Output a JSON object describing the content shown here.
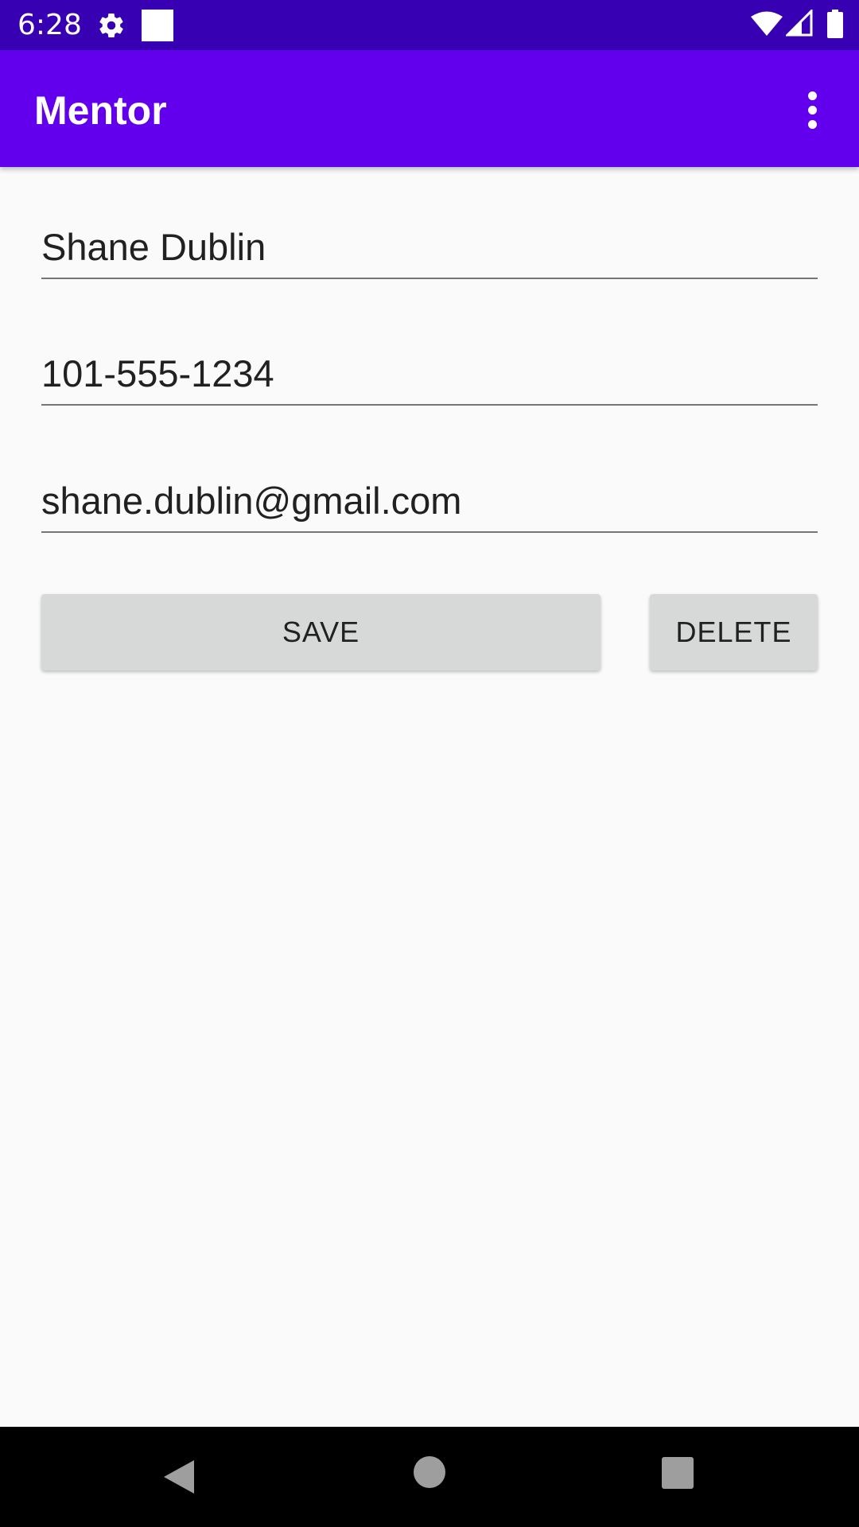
{
  "status_bar": {
    "time": "6:28",
    "icons": [
      "gear-icon",
      "notification-square-icon",
      "wifi-icon",
      "signal-icon",
      "battery-icon"
    ]
  },
  "app_bar": {
    "title": "Mentor",
    "menu_icon": "more-vert-icon"
  },
  "form": {
    "name_value": "Shane Dublin",
    "phone_value": "101-555-1234",
    "email_value": "shane.dublin@gmail.com"
  },
  "buttons": {
    "save_label": "SAVE",
    "delete_label": "DELETE"
  },
  "nav_bar": {
    "icons": [
      "back-icon",
      "home-icon",
      "recents-icon"
    ]
  },
  "colors": {
    "status_bar": "#3700b3",
    "app_bar": "#6200ee",
    "background": "#fafafa",
    "button": "#d7d8d8",
    "nav_bar": "#000000"
  }
}
